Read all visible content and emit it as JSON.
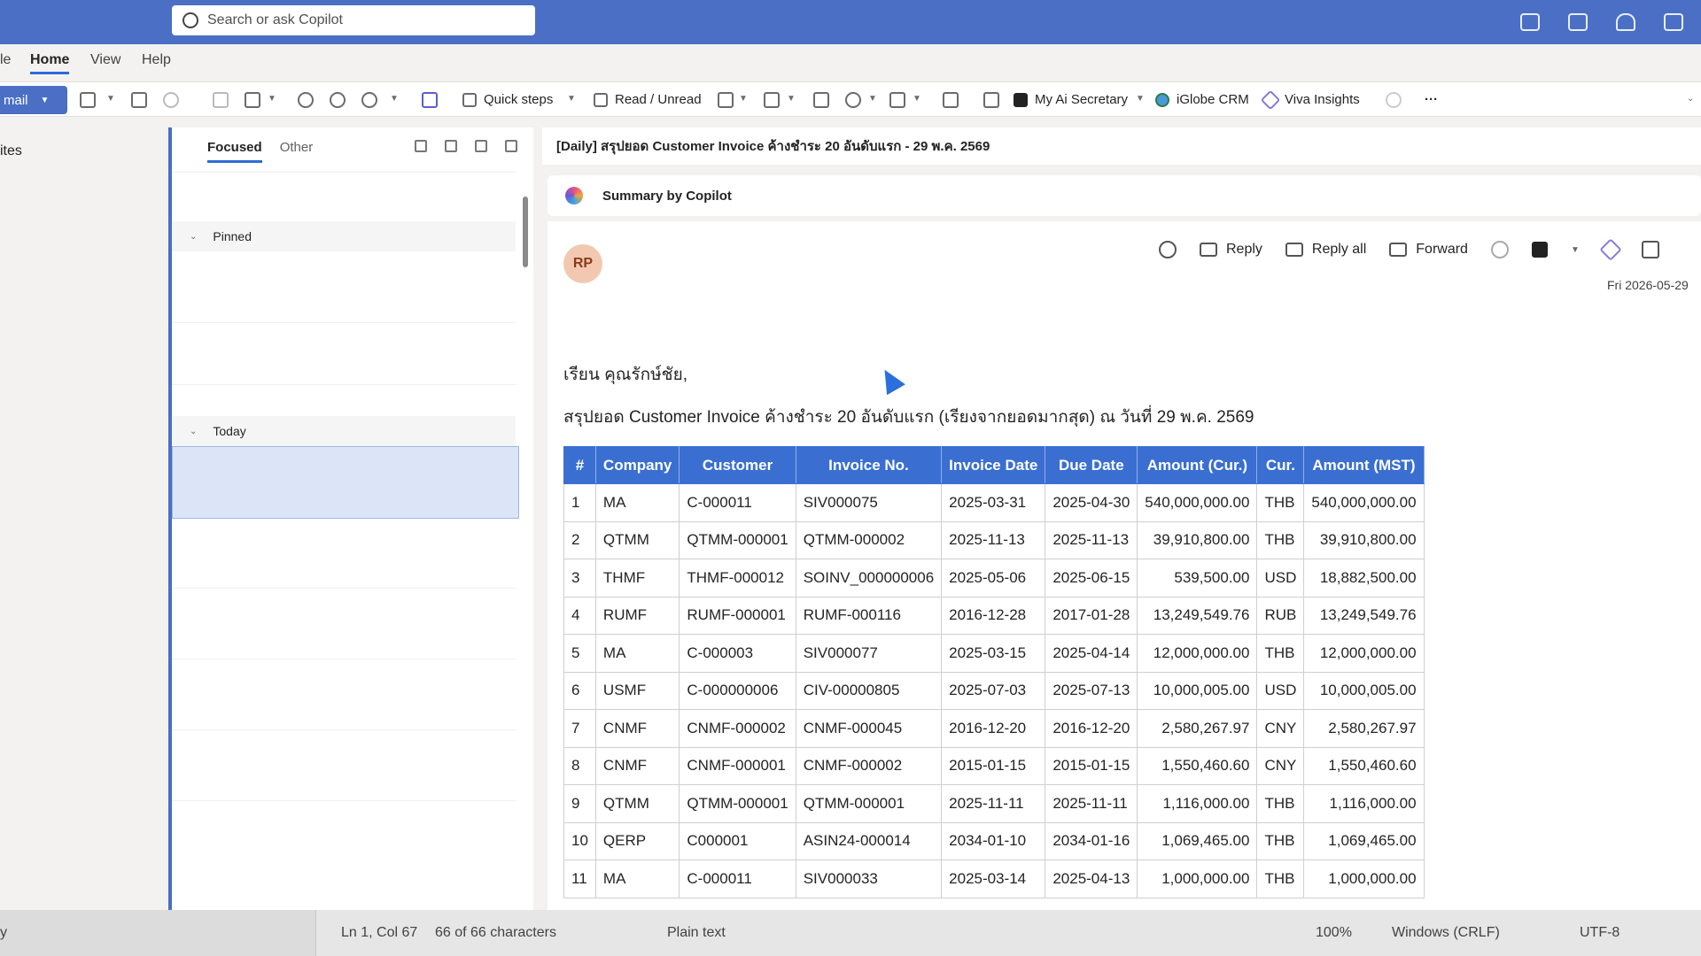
{
  "search": {
    "placeholder": "Search or ask Copilot"
  },
  "menu": {
    "file": "le",
    "home": "Home",
    "view": "View",
    "help": "Help"
  },
  "ribbon": {
    "new_mail": "mail",
    "quick_steps": "Quick steps",
    "read_unread": "Read / Unread",
    "my_ai_secretary": "My Ai Secretary",
    "iglobe_crm": "iGlobe CRM",
    "viva_insights": "Viva Insights",
    "more": "···"
  },
  "leftnav": {
    "favorites": "ites"
  },
  "message_list": {
    "tab_focused": "Focused",
    "tab_other": "Other",
    "group_pinned": "Pinned",
    "group_today": "Today"
  },
  "reading_pane": {
    "subject": "[Daily] สรุปยอด Customer Invoice ค้างชำระ 20 อันดับแรก - 29 พ.ค. 2569",
    "copilot_summary": "Summary by Copilot",
    "avatar_initials": "RP",
    "reply": "Reply",
    "reply_all": "Reply all",
    "forward": "Forward",
    "date": "Fri 2026-05-29",
    "greeting": "เรียน คุณรักษ์ชัย,",
    "intro": "สรุปยอด Customer Invoice ค้างชำระ 20 อันดับแรก (เรียงจากยอดมากสุด) ณ วันที่ 29 พ.ค. 2569"
  },
  "table": {
    "headers": [
      "#",
      "Company",
      "Customer",
      "Invoice No.",
      "Invoice Date",
      "Due Date",
      "Amount (Cur.)",
      "Cur.",
      "Amount (MST)"
    ],
    "rows": [
      [
        "1",
        "MA",
        "C-000011",
        "SIV000075",
        "2025-03-31",
        "2025-04-30",
        "540,000,000.00",
        "THB",
        "540,000,000.00"
      ],
      [
        "2",
        "QTMM",
        "QTMM-000001",
        "QTMM-000002",
        "2025-11-13",
        "2025-11-13",
        "39,910,800.00",
        "THB",
        "39,910,800.00"
      ],
      [
        "3",
        "THMF",
        "THMF-000012",
        "SOINV_000000006",
        "2025-05-06",
        "2025-06-15",
        "539,500.00",
        "USD",
        "18,882,500.00"
      ],
      [
        "4",
        "RUMF",
        "RUMF-000001",
        "RUMF-000116",
        "2016-12-28",
        "2017-01-28",
        "13,249,549.76",
        "RUB",
        "13,249,549.76"
      ],
      [
        "5",
        "MA",
        "C-000003",
        "SIV000077",
        "2025-03-15",
        "2025-04-14",
        "12,000,000.00",
        "THB",
        "12,000,000.00"
      ],
      [
        "6",
        "USMF",
        "C-000000006",
        "CIV-00000805",
        "2025-07-03",
        "2025-07-13",
        "10,000,005.00",
        "USD",
        "10,000,005.00"
      ],
      [
        "7",
        "CNMF",
        "CNMF-000002",
        "CNMF-000045",
        "2016-12-20",
        "2016-12-20",
        "2,580,267.97",
        "CNY",
        "2,580,267.97"
      ],
      [
        "8",
        "CNMF",
        "CNMF-000001",
        "CNMF-000002",
        "2015-01-15",
        "2015-01-15",
        "1,550,460.60",
        "CNY",
        "1,550,460.60"
      ],
      [
        "9",
        "QTMM",
        "QTMM-000001",
        "QTMM-000001",
        "2025-11-11",
        "2025-11-11",
        "1,116,000.00",
        "THB",
        "1,116,000.00"
      ],
      [
        "10",
        "QERP",
        "C000001",
        "ASIN24-000014",
        "2034-01-10",
        "2034-01-16",
        "1,069,465.00",
        "THB",
        "1,069,465.00"
      ],
      [
        "11",
        "MA",
        "C-000011",
        "SIV000033",
        "2025-03-14",
        "2025-04-13",
        "1,000,000.00",
        "THB",
        "1,000,000.00"
      ]
    ]
  },
  "statusbar": {
    "left": "y",
    "position": "Ln 1, Col 67",
    "chars": "66 of 66 characters",
    "format": "Plain text",
    "zoom": "100%",
    "eol": "Windows (CRLF)",
    "encoding": "UTF-8"
  }
}
